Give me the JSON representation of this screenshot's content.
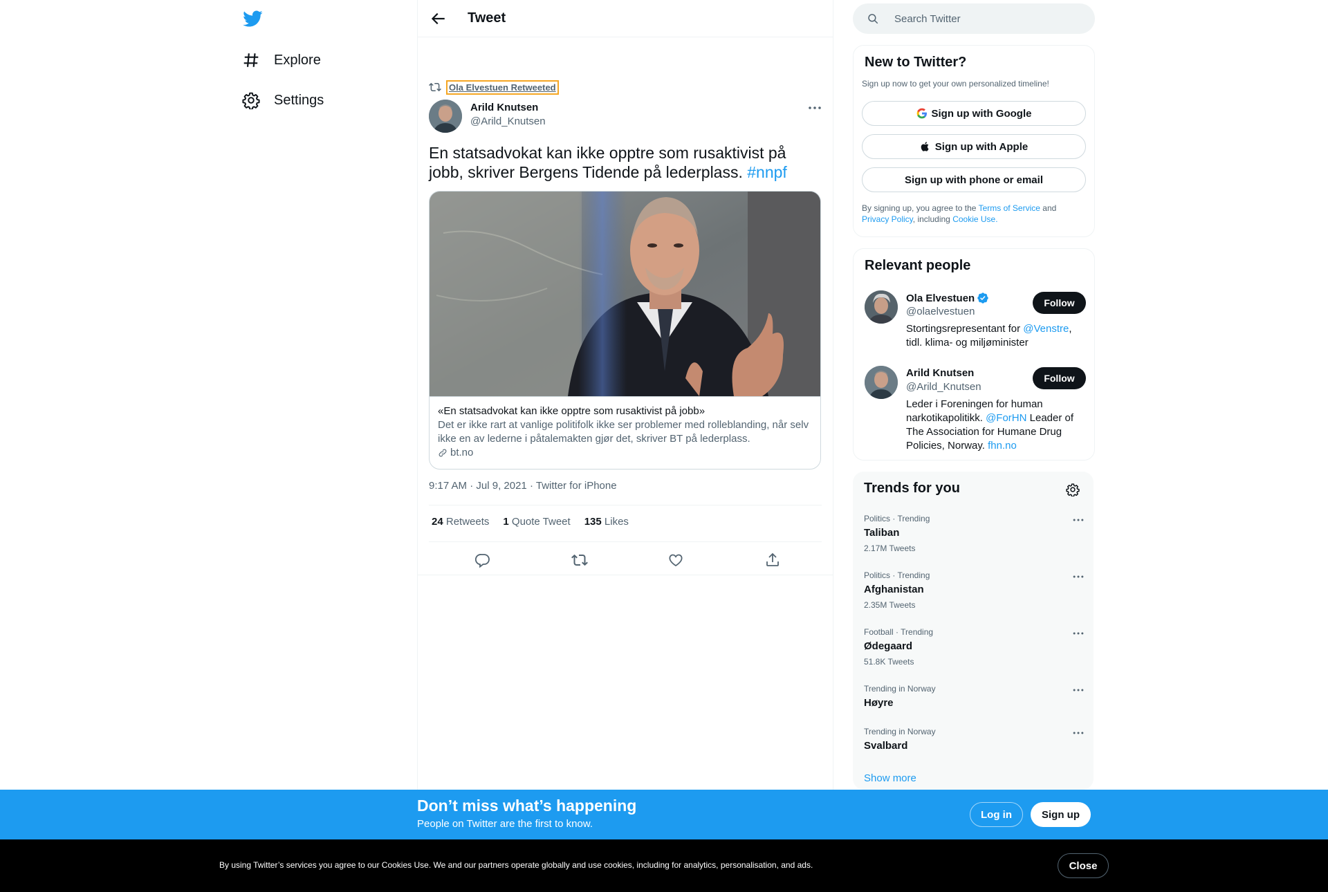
{
  "nav": {
    "items": [
      {
        "label": "Explore",
        "icon": "hashtag-icon"
      },
      {
        "label": "Settings",
        "icon": "gear-icon"
      }
    ]
  },
  "header": {
    "title": "Tweet"
  },
  "tweet": {
    "retweeted_by": "Ola Elvestuen Retweeted",
    "author_name": "Arild Knutsen",
    "author_handle": "@Arild_Knutsen",
    "text": "En statsadvokat kan ikke opptre som rusaktivist på jobb, skriver Bergens Tidende på lederplass.",
    "hashtag": "#nnpf",
    "card": {
      "title": "«En statsadvokat kan ikke opptre som rusaktivist på jobb»",
      "description": "Det er ikke rart at vanlige politifolk ikke ser problemer med rolleblanding, når selv ikke en av lederne i påtalemakten gjør det, skriver BT på lederplass.",
      "domain": "bt.no"
    },
    "time": "9:17 AM",
    "date": "Jul 9, 2021",
    "source": "Twitter for iPhone",
    "stats": {
      "retweets_count": "24",
      "retweets_label": "Retweets",
      "quotes_count": "1",
      "quotes_label": "Quote Tweet",
      "likes_count": "135",
      "likes_label": "Likes"
    }
  },
  "search": {
    "placeholder": "Search Twitter"
  },
  "new_to_twitter": {
    "title": "New to Twitter?",
    "subtitle": "Sign up now to get your own personalized timeline!",
    "google": "Sign up with Google",
    "apple": "Sign up with Apple",
    "phone": "Sign up with phone or email",
    "legal_1": "By signing up, you agree to the",
    "tos": "Terms of Service",
    "legal_2": "and",
    "privacy": "Privacy Policy",
    "legal_3": ", including",
    "cookie": "Cookie Use."
  },
  "relevant": {
    "title": "Relevant people",
    "people": [
      {
        "name": "Ola Elvestuen",
        "handle": "@olaelvestuen",
        "verified": true,
        "bio_1": "Stortingsrepresentant for",
        "bio_link": "@Venstre",
        "bio_2": ", tidl. klima- og miljøminister",
        "follow": "Follow"
      },
      {
        "name": "Arild Knutsen",
        "handle": "@Arild_Knutsen",
        "verified": false,
        "bio_1": "Leder i Foreningen for human narkotikapolitikk.",
        "bio_link": "@ForHN",
        "bio_2": "Leader of The Association for Humane Drug Policies, Norway.",
        "bio_link2": "fhn.no",
        "follow": "Follow"
      }
    ]
  },
  "trends": {
    "title": "Trends for you",
    "items": [
      {
        "context": "Politics · Trending",
        "name": "Taliban",
        "count": "2.17M Tweets"
      },
      {
        "context": "Politics · Trending",
        "name": "Afghanistan",
        "count": "2.35M Tweets"
      },
      {
        "context": "Football · Trending",
        "name": "Ødegaard",
        "count": "51.8K Tweets"
      },
      {
        "context": "Trending in Norway",
        "name": "Høyre",
        "count": ""
      },
      {
        "context": "Trending in Norway",
        "name": "Svalbard",
        "count": ""
      }
    ],
    "show_more": "Show more"
  },
  "banner": {
    "title": "Don’t miss what’s happening",
    "subtitle": "People on Twitter are the first to know.",
    "login": "Log in",
    "signup": "Sign up"
  },
  "cookie_bar": {
    "text_1": "By using Twitter’s services you agree to our",
    "link": "Cookies Use",
    "text_2": ". We and our partners operate globally and use cookies, including for analytics, personalisation, and ads.",
    "close": "Close"
  },
  "colors": {
    "accent": "#1d9bf0",
    "text": "#0f1419",
    "muted": "#536471",
    "border": "#eff3f4"
  }
}
